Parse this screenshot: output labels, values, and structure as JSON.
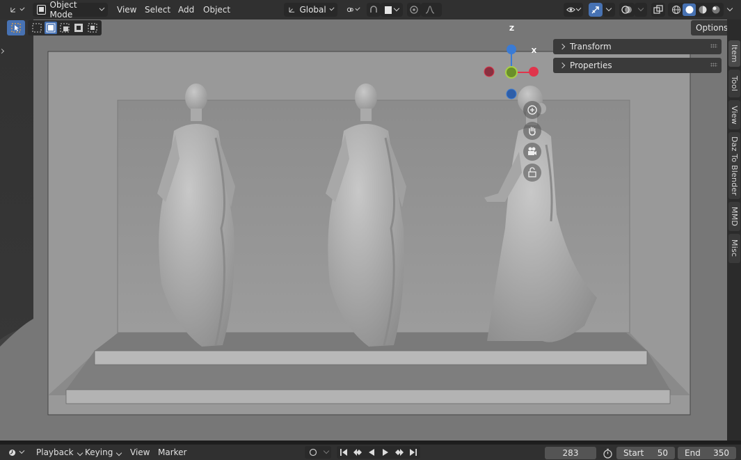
{
  "header": {
    "editor_type_icon": "viewport-editor-icon",
    "mode": "Object Mode",
    "menus": [
      "View",
      "Select",
      "Add",
      "Object"
    ],
    "orientation": "Global",
    "snap_icon": "snap-icon",
    "proportional_icon": "proportional-edit-icon"
  },
  "viewport": {
    "options_label": "Options",
    "panels": [
      "Transform",
      "Properties"
    ],
    "gizmo": {
      "z": "Z",
      "x": "X"
    },
    "sidebar_tabs": [
      "Item",
      "Tool",
      "View",
      "Daz To Blender",
      "MMD",
      "Misc"
    ]
  },
  "timeline": {
    "menus": [
      "Playback",
      "Keying",
      "View",
      "Marker"
    ],
    "current_frame": "283",
    "start_label": "Start",
    "start_value": "50",
    "end_label": "End",
    "end_value": "350"
  },
  "colors": {
    "accent": "#4772b3",
    "axis_x": "#e0354c",
    "axis_y": "#75a02a",
    "axis_z": "#3a7bd5"
  }
}
